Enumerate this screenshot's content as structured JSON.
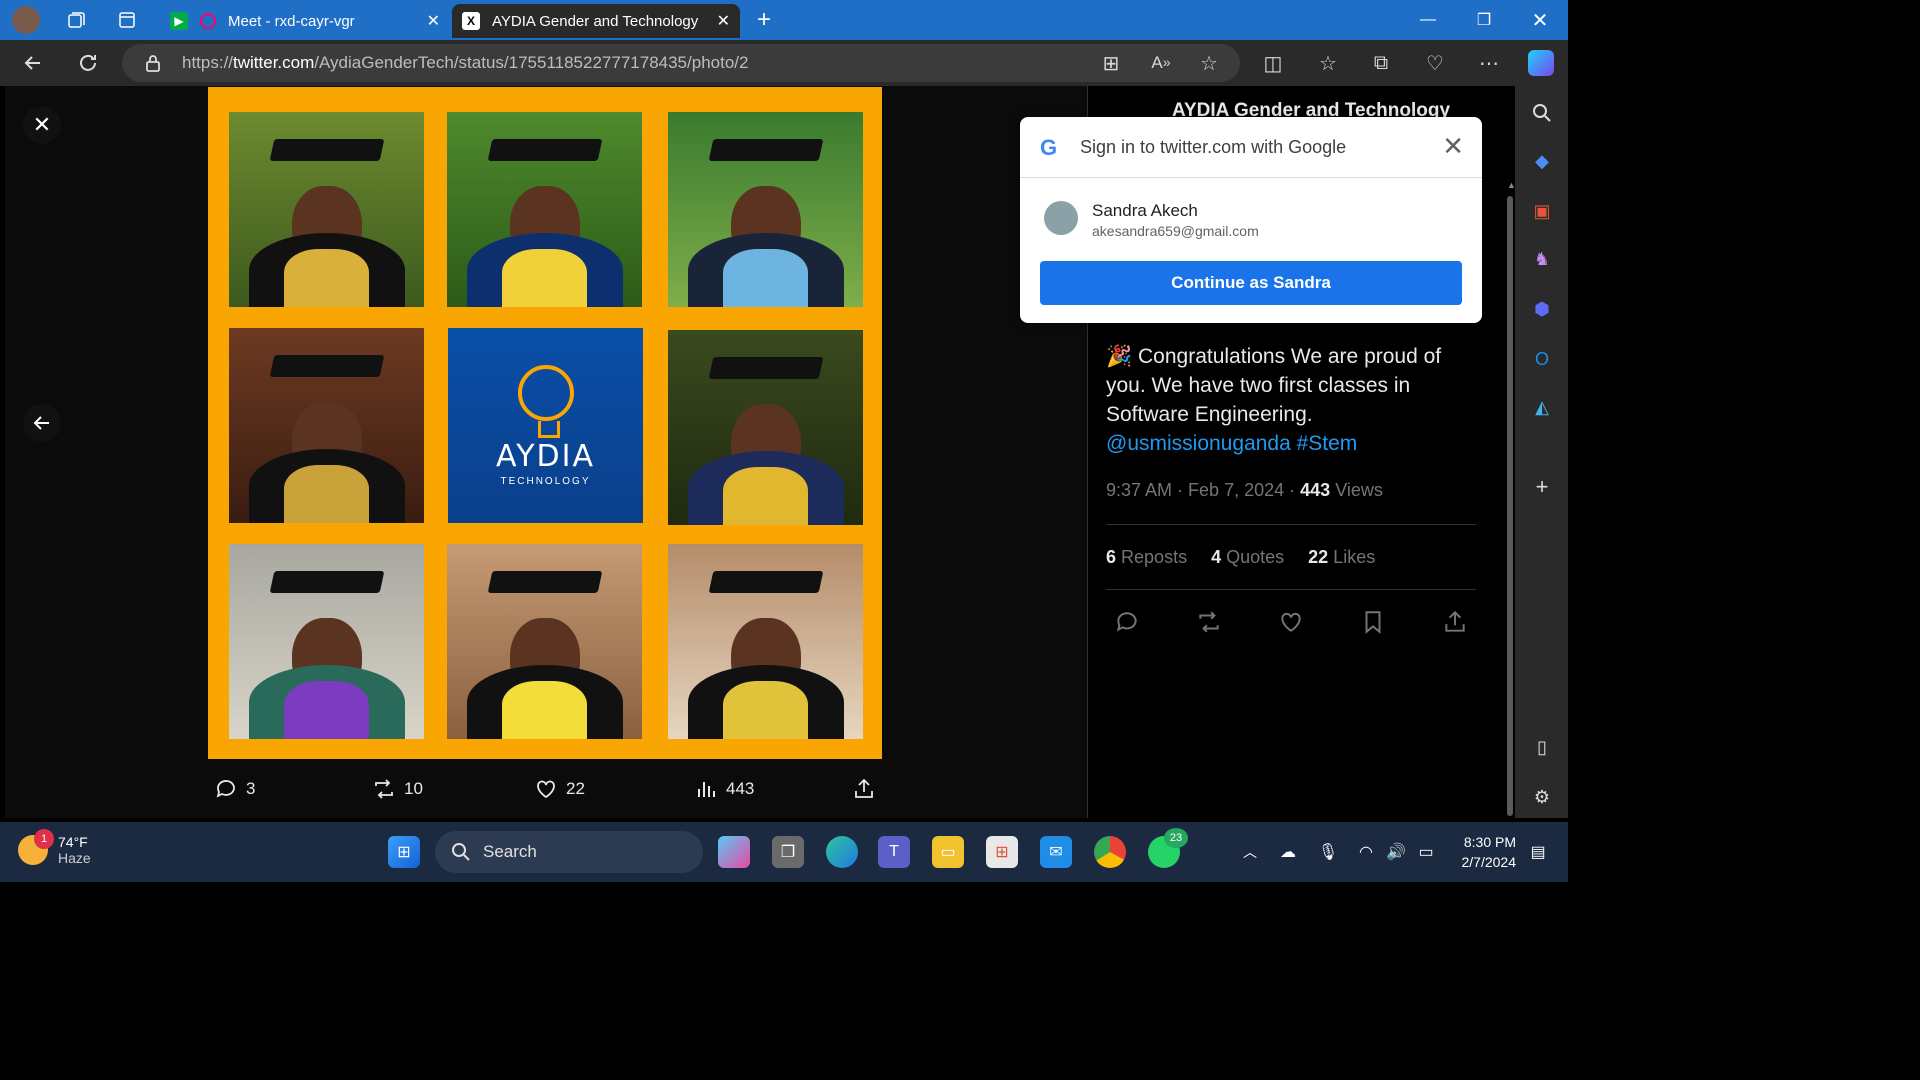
{
  "browser": {
    "tabs": [
      {
        "title": "Meet - rxd-cayr-vgr",
        "active": false
      },
      {
        "title": "AYDIA Gender and Technology In",
        "active": true
      }
    ],
    "url_prefix": "https://",
    "url_host": "twitter.com",
    "url_path": "/AydiaGenderTech/status/1755118522777178435/photo/2"
  },
  "media": {
    "logo_name": "AYDIA",
    "logo_sub": "TECHNOLOGY",
    "actions": {
      "replies": "3",
      "reposts": "10",
      "likes": "22",
      "views": "443"
    }
  },
  "tweet": {
    "author": "AYDIA Gender and Technology",
    "text_emoji": "🎉",
    "text": "Congratulations We are proud of you. We have two first classes in Software Engineering.",
    "mentions": "@usmissionuganda #Stem",
    "time": "9:37 AM",
    "date": "Feb 7, 2024",
    "views_count": "443",
    "views_label": "Views",
    "reposts_count": "6",
    "reposts_label": "Reposts",
    "quotes_count": "4",
    "quotes_label": "Quotes",
    "likes_count": "22",
    "likes_label": "Likes"
  },
  "google_popup": {
    "title": "Sign in to twitter.com with Google",
    "name": "Sandra Akech",
    "email": "akesandra659@gmail.com",
    "button": "Continue as Sandra"
  },
  "taskbar": {
    "weather_temp": "74°F",
    "weather_cond": "Haze",
    "weather_badge": "1",
    "search_label": "Search",
    "whatsapp_badge": "23",
    "time": "8:30 PM",
    "date": "2/7/2024"
  }
}
